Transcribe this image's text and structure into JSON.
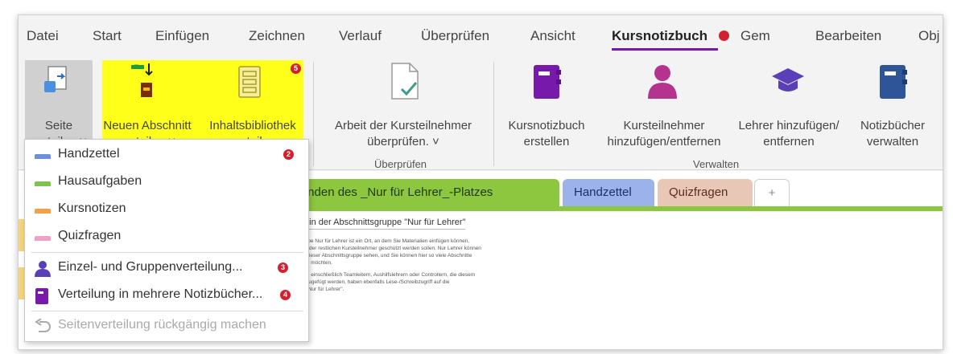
{
  "menu": {
    "tabs": [
      {
        "label": "Datei"
      },
      {
        "label": "Start"
      },
      {
        "label": "Einfügen"
      },
      {
        "label": "Zeichnen"
      },
      {
        "label": "Verlauf"
      },
      {
        "label": "Überprüfen"
      },
      {
        "label": "Ansicht"
      },
      {
        "label": "Kursnotizbuch"
      },
      {
        "label": "Gem"
      },
      {
        "label": "Bearbeiten"
      },
      {
        "label": "Obj"
      }
    ],
    "active_tab": "Kursnotizbuch"
  },
  "ribbon": {
    "seite": {
      "line1": "Seite",
      "line2": "verteilen ˅"
    },
    "neuer_abschnitt": {
      "line1": "Neuen Abschnitt",
      "line2": "verteilen ˅"
    },
    "inhaltsbibliothek": {
      "line1": "Inhaltsbibliothek",
      "line2": "verteilen"
    },
    "arbeit": {
      "line1": "Arbeit der Kursteilnehmer",
      "line2": "überprüfen. ˅"
    },
    "kursnotizbuch_erstellen": {
      "line1": "Kursnotizbuch",
      "line2": "erstellen"
    },
    "kursteilnehmer": {
      "line1": "Kursteilnehmer",
      "line2": "hinzufügen/entfernen"
    },
    "lehrer": {
      "line1": "Lehrer hinzufügen/",
      "line2": "entfernen"
    },
    "notizbuecher": {
      "line1": "Notizbücher",
      "line2": "verwalten"
    },
    "groups": {
      "ueberpruefen": "Überprüfen",
      "verwalten": "Verwalten"
    },
    "badge_5": "5"
  },
  "dropdown": {
    "items": [
      {
        "label": "Handzettel",
        "badge": "2"
      },
      {
        "label": "Hausaufgaben"
      },
      {
        "label": "Kursnotizen"
      },
      {
        "label": "Quizfragen"
      },
      {
        "label": "Einzel- und Gruppenverteilung...",
        "badge": "3"
      },
      {
        "label": "Verteilung in mehrere Notizbücher...",
        "badge": "4"
      },
      {
        "label": "Seitenverteilung rückgängig machen"
      }
    ]
  },
  "content": {
    "section_tabs": [
      {
        "label": "wenden des _Nur für Lehrer_-Platzes"
      },
      {
        "label": "Handzettel"
      },
      {
        "label": "Quizfragen"
      },
      {
        "label": "+"
      }
    ],
    "page_title": "e in der Abschnittsgruppe \"Nur für Lehrer\"",
    "page_lines": [
      "uppe Nur für Lehrer ist ein Ort, an dem Sie Materialien einfügen können,",
      "en der restlichen Kursteilnehmer geschützt werden sollen. Nur Lehrer können",
      "n dieser Abschnittsgruppe sehen, und Sie können hier so viele Abschnitte",
      "Sie möchten.",
      "rer, einschließlich Teamleitern, Aushilfslehrern oder Controllern, die diesem",
      "inzugefügt werden, haben ebenfalls Lese-/Schreibzugriff auf die",
      "e \"Nur für Lehrer\"."
    ]
  },
  "colors": {
    "accent": "#7719aa",
    "highlight": "#ffff1a",
    "badge": "#d3202e",
    "green_section": "#8dc63f",
    "handzettel": "#6f8fd8",
    "quizfragen": "#f0a1c8"
  }
}
